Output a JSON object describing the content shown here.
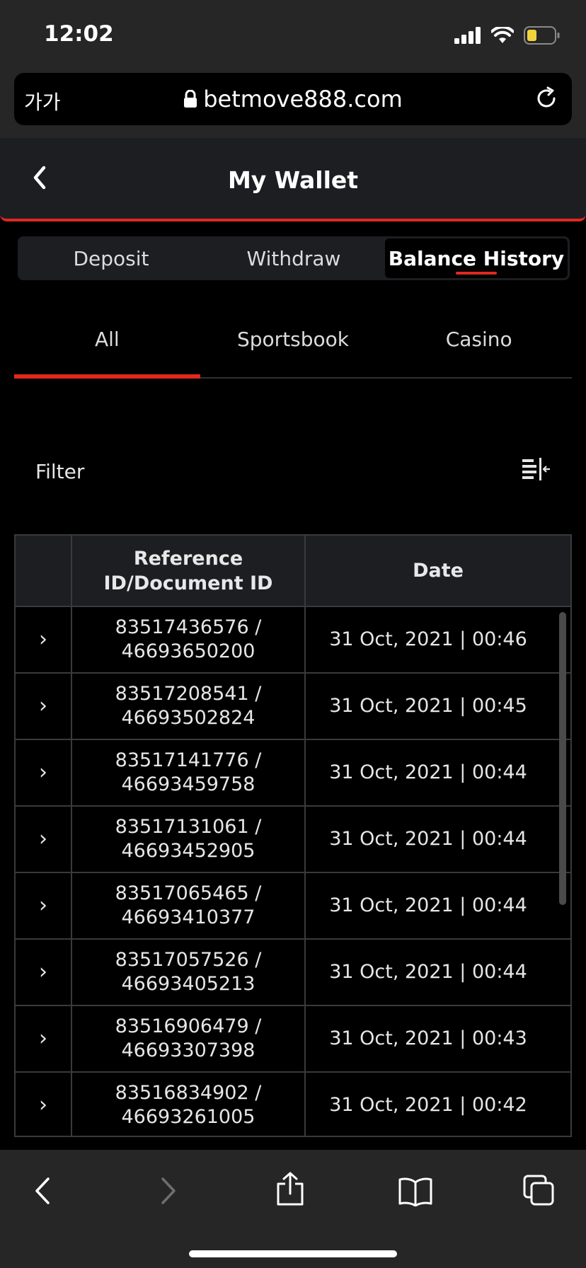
{
  "status": {
    "time": "12:02"
  },
  "browser": {
    "text_size_label": "가가",
    "url": "betmove888.com"
  },
  "header": {
    "title": "My Wallet"
  },
  "wallet_tabs": [
    {
      "label": "Deposit",
      "active": false
    },
    {
      "label": "Withdraw",
      "active": false
    },
    {
      "label": "Balance History",
      "active": true
    }
  ],
  "sub_tabs": [
    {
      "label": "All",
      "active": true
    },
    {
      "label": "Sportsbook",
      "active": false
    },
    {
      "label": "Casino",
      "active": false
    }
  ],
  "filter": {
    "label": "Filter"
  },
  "table": {
    "headers": {
      "ref_line1": "Reference",
      "ref_line2": "ID/Document ID",
      "date": "Date"
    },
    "rows": [
      {
        "ref": "83517436576 /",
        "doc": "46693650200",
        "date": "31 Oct, 2021 | 00:46"
      },
      {
        "ref": "83517208541 /",
        "doc": "46693502824",
        "date": "31 Oct, 2021 | 00:45"
      },
      {
        "ref": "83517141776 /",
        "doc": "46693459758",
        "date": "31 Oct, 2021 | 00:44"
      },
      {
        "ref": "83517131061 /",
        "doc": "46693452905",
        "date": "31 Oct, 2021 | 00:44"
      },
      {
        "ref": "83517065465 /",
        "doc": "46693410377",
        "date": "31 Oct, 2021 | 00:44"
      },
      {
        "ref": "83517057526 /",
        "doc": "46693405213",
        "date": "31 Oct, 2021 | 00:44"
      },
      {
        "ref": "83516906479 /",
        "doc": "46693307398",
        "date": "31 Oct, 2021 | 00:43"
      },
      {
        "ref": "83516834902 /",
        "doc": "46693261005",
        "date": "31 Oct, 2021 | 00:42"
      }
    ]
  },
  "colors": {
    "accent": "#e0281e",
    "header_bg": "#1c1e22",
    "browser_chrome": "#262626"
  },
  "icons": [
    "signal-icon",
    "wifi-icon",
    "battery-icon",
    "lock-icon",
    "reload-icon",
    "back-chevron-icon",
    "filter-icon",
    "chevron-right-icon",
    "browser-back-icon",
    "browser-forward-icon",
    "share-icon",
    "bookmarks-icon",
    "tabs-icon"
  ]
}
